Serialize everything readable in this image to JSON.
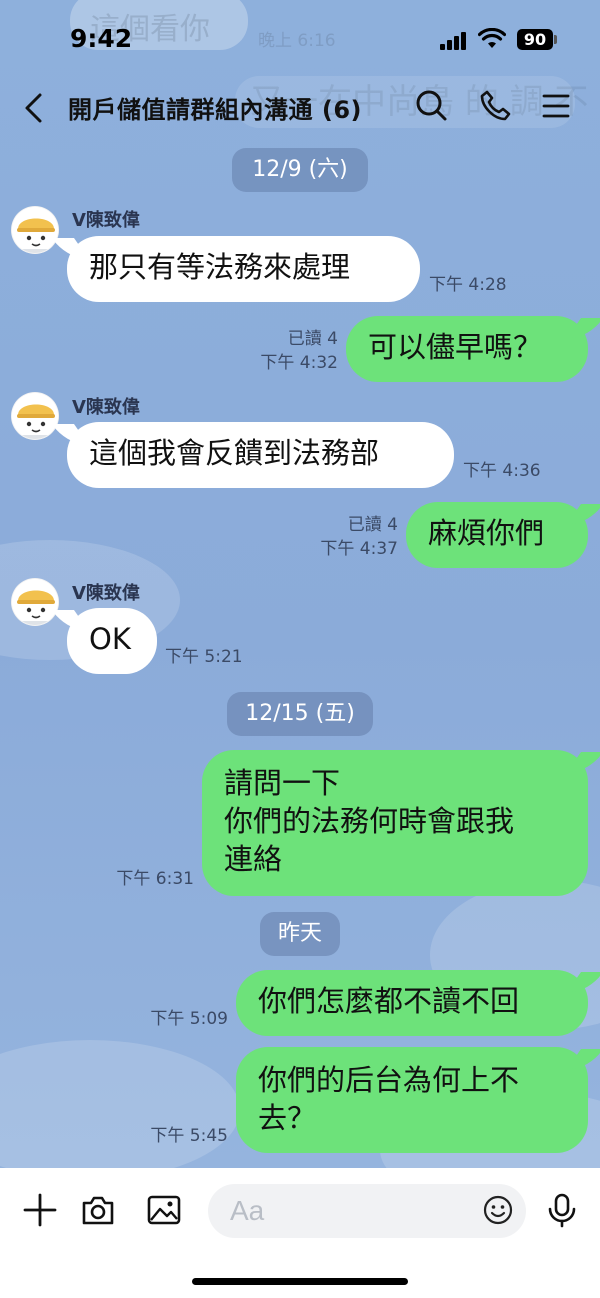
{
  "status_bar": {
    "time": "9:42",
    "battery": "90"
  },
  "background_ghost": {
    "message": "這個看你",
    "time": "晚上 6:16",
    "line": "又一在中尚鳥 的 調 不 到 錯"
  },
  "header": {
    "title": "開戶儲值請群組內溝通 (6)"
  },
  "dates": {
    "d1": "12/9 (六)",
    "d2": "12/15 (五)",
    "d3": "昨天"
  },
  "messages": {
    "m1": {
      "sender": "V陳致偉",
      "text": "那只有等法務來處理",
      "time": "下午 4:28"
    },
    "m2": {
      "read": "已讀 4",
      "time": "下午 4:32",
      "text": "可以儘早嗎？"
    },
    "m3": {
      "sender": "V陳致偉",
      "text": "這個我會反饋到法務部",
      "time": "下午 4:36"
    },
    "m4": {
      "read": "已讀 4",
      "time": "下午 4:37",
      "text": "麻煩你們"
    },
    "m5": {
      "sender": "V陳致偉",
      "text": "OK",
      "time": "下午 5:21"
    },
    "m6": {
      "lines": [
        "請問一下",
        "你們的法務何時會跟我",
        "連絡"
      ],
      "time": "下午 6:31"
    },
    "m7": {
      "text": "你們怎麼都不讀不回",
      "time": "下午 5:09"
    },
    "m8": {
      "lines": [
        "你們的后台為何上不",
        "去？"
      ],
      "time": "下午 5:45"
    }
  },
  "input_bar": {
    "placeholder": "Aa"
  },
  "colors": {
    "chat_bg": "#8aaedb",
    "outgoing_bubble": "#6de27a",
    "incoming_bubble": "#ffffff"
  }
}
